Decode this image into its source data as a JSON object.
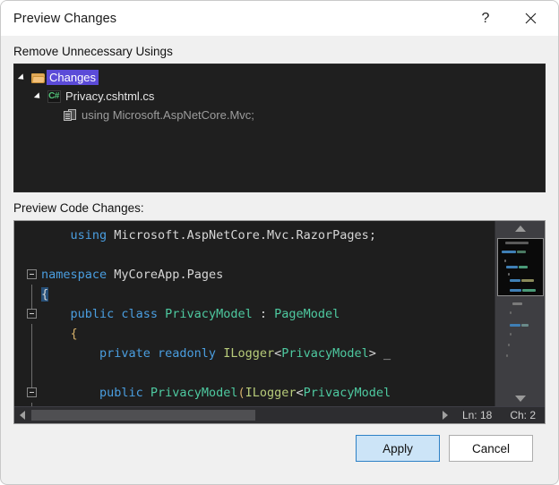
{
  "window": {
    "title": "Preview Changes",
    "help_icon": "question-mark-icon",
    "close_icon": "close-icon"
  },
  "tree_section": {
    "label": "Remove Unnecessary Usings",
    "items": [
      {
        "label": "Changes",
        "icon": "folder-icon",
        "selected": true,
        "expanded": true,
        "depth": 0
      },
      {
        "label": "Privacy.cshtml.cs",
        "icon": "csharp-file-icon",
        "selected": false,
        "expanded": true,
        "depth": 1
      },
      {
        "label": "using Microsoft.AspNetCore.Mvc;",
        "icon": "code-document-icon",
        "selected": false,
        "expanded": false,
        "depth": 2
      }
    ]
  },
  "code_section": {
    "label": "Preview Code Changes:",
    "lines": [
      "    using Microsoft.AspNetCore.Mvc.RazorPages;",
      "",
      "namespace MyCoreApp.Pages",
      "{",
      "    public class PrivacyModel : PageModel",
      "    {",
      "        private readonly ILogger<PrivacyModel> _",
      "",
      "        public PrivacyModel(ILogger<PrivacyModel",
      "        {"
    ],
    "status": {
      "line_label": "Ln: 18",
      "column_label": "Ch: 2"
    },
    "scroll": {
      "up_arrow_icon": "scroll-up-arrow-icon",
      "down_arrow_icon": "scroll-down-arrow-icon",
      "left_arrow_icon": "scroll-left-arrow-icon",
      "right_arrow_icon": "scroll-right-arrow-icon"
    }
  },
  "footer": {
    "apply_label": "Apply",
    "cancel_label": "Cancel"
  },
  "colors": {
    "dialog_bg": "#f0f0f0",
    "titlebar_bg": "#ffffff",
    "panel_bg": "#1e1e1e",
    "tree_bg": "#1f1f1f",
    "selection": "#5b4bd8",
    "keyword": "#4a9ee0",
    "type": "#4ec9a0",
    "interface": "#b8cc7a",
    "plain": "#d6d6d6",
    "brace": "#d4b06a",
    "caret_selection": "#264f78",
    "apply_bg": "#cce4f7",
    "apply_border": "#2e81c6",
    "folder_icon": "#e0a85a",
    "csharp_icon": "#54c47a"
  }
}
